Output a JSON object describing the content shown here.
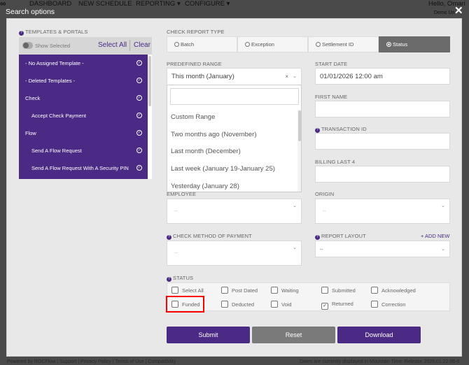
{
  "nav": {
    "items": [
      "DASHBOARD",
      "NEW SCHEDULE",
      "REPORTING ▾",
      "CONFIGURE ▾"
    ],
    "greeting": "Hello, Omari",
    "org": "Demo Un"
  },
  "dialog": {
    "title": "Search options",
    "close": "✕"
  },
  "templates": {
    "label": "TEMPLATES & PORTALS",
    "show_selected": "Show Selected",
    "select_all": "Select All",
    "clear": "Clear",
    "items": [
      {
        "label": "- No Assigned Template -",
        "indent": false
      },
      {
        "label": "- Deleted Templates -",
        "indent": false
      },
      {
        "label": "Check",
        "indent": false
      },
      {
        "label": "Accept Check Payment",
        "indent": true
      },
      {
        "label": "Flow",
        "indent": false
      },
      {
        "label": "Send A Flow Request",
        "indent": true
      },
      {
        "label": "Send A Flow Request With A Security PIN",
        "indent": true
      }
    ]
  },
  "report_type": {
    "label": "CHECK REPORT TYPE",
    "options": [
      "Batch",
      "Exception",
      "Settlement ID",
      "Status"
    ],
    "selected": "Status"
  },
  "predefined_range": {
    "label": "PREDEFINED RANGE",
    "value": "This month (January)",
    "search_value": "",
    "options": [
      "Custom Range",
      "Two months ago (November)",
      "Last month (December)",
      "Last week (January 19-January 25)",
      "Yesterday (January 28)"
    ]
  },
  "start_date": {
    "label": "START DATE",
    "value": "01/01/2026 12:00 am"
  },
  "first_name": {
    "label": "FIRST NAME",
    "value": ""
  },
  "transaction_id": {
    "label": "TRANSACTION ID",
    "value": ""
  },
  "billing_last4": {
    "label": "BILLING LAST 4",
    "value": ""
  },
  "employee": {
    "label": "EMPLOYEE",
    "placeholder": "--"
  },
  "origin": {
    "label": "ORIGIN",
    "placeholder": "--"
  },
  "method": {
    "label": "CHECK METHOD OF PAYMENT",
    "placeholder": "--"
  },
  "layout": {
    "label": "REPORT LAYOUT",
    "value": "--",
    "add_new": "+ ADD NEW"
  },
  "status": {
    "label": "STATUS",
    "items": [
      {
        "label": "Select All",
        "checked": false
      },
      {
        "label": "Post Dated",
        "checked": false
      },
      {
        "label": "Waiting",
        "checked": false
      },
      {
        "label": "Submitted",
        "checked": false
      },
      {
        "label": "Acknowledged",
        "checked": false
      },
      {
        "label": "Funded",
        "checked": false
      },
      {
        "label": "Deducted",
        "checked": false
      },
      {
        "label": "Void",
        "checked": false
      },
      {
        "label": "Returned",
        "checked": true
      },
      {
        "label": "Correction",
        "checked": false
      }
    ]
  },
  "buttons": {
    "submit": "Submit",
    "reset": "Reset",
    "download": "Download"
  },
  "footer": {
    "left": "Powered by ROCFlow | Support | Privacy Policy | Terms of Use | Compatibility",
    "right": "Dates are currently displayed in Mountain Time. Release 2026.01.22.06-0"
  },
  "colors": {
    "accent": "#4b2a85",
    "highlight": "#ff0000"
  }
}
